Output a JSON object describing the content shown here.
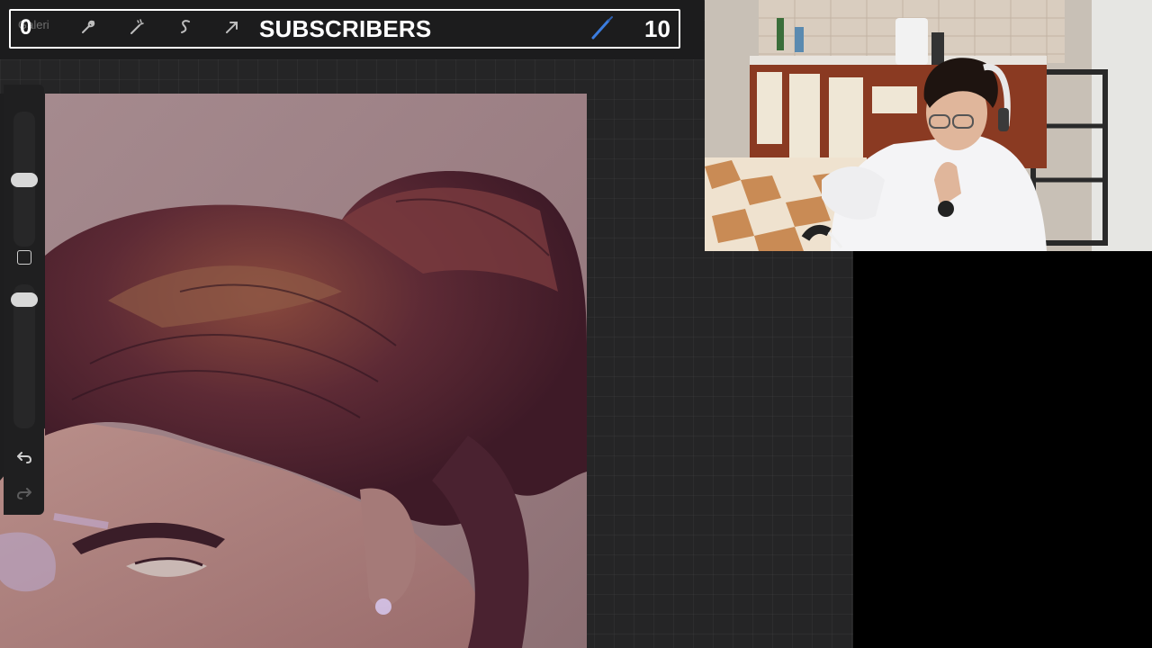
{
  "toolbar": {
    "gallery_label": "Galeri",
    "counter_left": "0",
    "title": "SUBSCRIBERS",
    "counter_right": "10",
    "icons": [
      "wrench-icon",
      "magic-wand-icon",
      "selection-icon",
      "transform-arrow-icon",
      "brush-icon"
    ],
    "active_color": "#3b7de0"
  },
  "sidebar": {
    "controls": [
      "brush-size-slider",
      "modify-button",
      "opacity-slider",
      "undo-button",
      "redo-button"
    ]
  },
  "canvas": {
    "subject": "painted portrait close-up"
  },
  "webcam": {
    "subject": "streamer webcam feed"
  }
}
